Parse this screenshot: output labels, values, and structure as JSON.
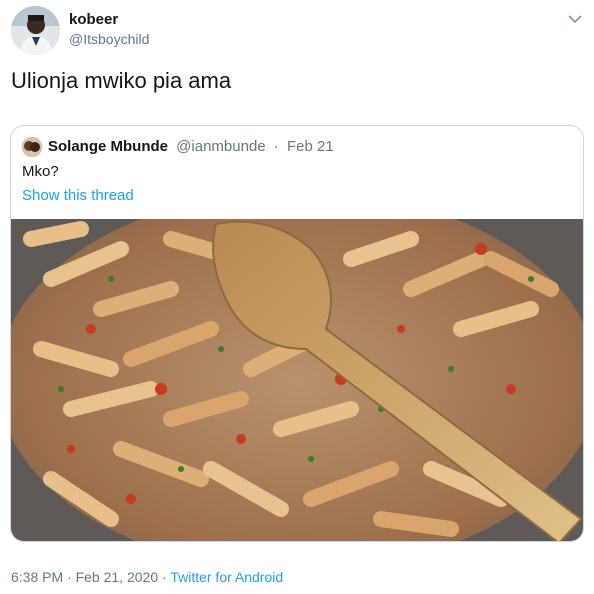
{
  "author": {
    "display_name": "kobeer",
    "handle": "@Itsboychild",
    "avatar_icon": "profile-photo"
  },
  "tweet": {
    "text": "Ulionja mwiko pia ama"
  },
  "quoted_tweet": {
    "display_name": "Solange Mbunde",
    "handle": "@ianmbunde",
    "separator": "·",
    "date": "Feb 21",
    "text": "Mko?",
    "thread_link": "Show this thread",
    "media_icon": "food-photo"
  },
  "footer": {
    "time": "6:38 PM",
    "separator": "·",
    "date": "Feb 21, 2020",
    "source": "Twitter for Android"
  },
  "colors": {
    "link": "#1da1f2",
    "muted": "#657786",
    "border": "#ccd6dd"
  }
}
